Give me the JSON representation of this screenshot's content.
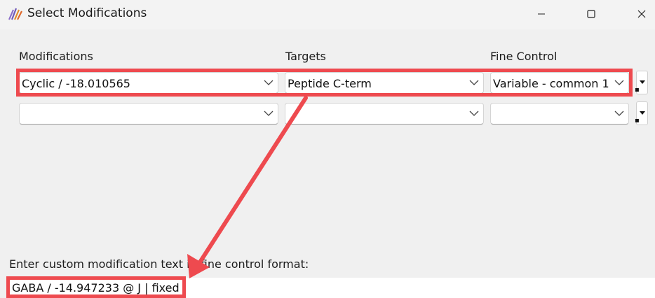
{
  "window": {
    "title": "Select Modifications",
    "icon": "app-logo-icon",
    "controls": [
      "minimize-icon",
      "maximize-icon",
      "close-icon"
    ]
  },
  "columns": {
    "modifications": "Modifications",
    "targets": "Targets",
    "fine_control": "Fine Control"
  },
  "rows": [
    {
      "modification": "Cyclic / -18.010565",
      "target": "Peptide C-term",
      "fine_control": "Variable - common 1"
    },
    {
      "modification": "",
      "target": "",
      "fine_control": ""
    }
  ],
  "custom": {
    "label": "Enter custom modification text in fine control format:",
    "value": "GABA / -14.947233 @ J | fixed"
  },
  "colors": {
    "highlight": "#ee4a4f",
    "window_bg": "#f0f0f0"
  }
}
